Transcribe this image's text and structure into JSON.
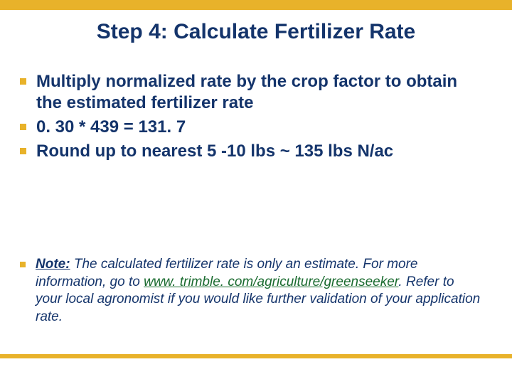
{
  "title": "Step 4: Calculate Fertilizer Rate",
  "bullets": [
    "Multiply normalized rate by the crop factor to obtain the estimated fertilizer rate",
    "0. 30 * 439 = 131. 7",
    "Round up to nearest 5 -10 lbs ~ 135 lbs N/ac"
  ],
  "note": {
    "label": "Note:",
    "before_link": " The  calculated fertilizer rate is only an estimate. For more information, go to ",
    "link": "www. trimble. com/agriculture/greenseeker",
    "after_link": ". Refer to your local agronomist if you would like further validation of your application rate."
  }
}
